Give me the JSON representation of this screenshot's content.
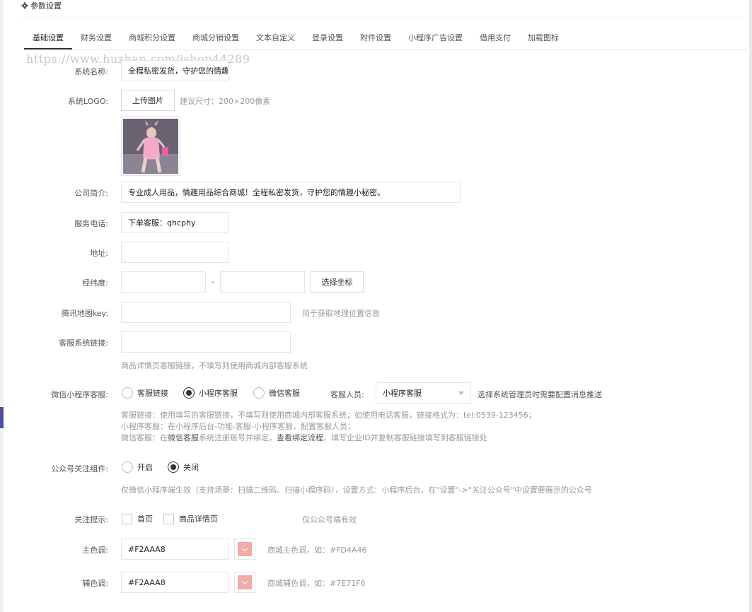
{
  "header": {
    "title": "参数设置",
    "icon": "gear-icon"
  },
  "tabs": [
    {
      "label": "基础设置",
      "active": true
    },
    {
      "label": "财务设置"
    },
    {
      "label": "商城积分设置"
    },
    {
      "label": "商城分销设置"
    },
    {
      "label": "文本自定义"
    },
    {
      "label": "登录设置"
    },
    {
      "label": "附件设置"
    },
    {
      "label": "小程序广告设置"
    },
    {
      "label": "借用支付"
    },
    {
      "label": "加载图标"
    }
  ],
  "watermark": "https://www.huzhan.com/ishop44289",
  "form": {
    "system_name": {
      "label": "系统名称:",
      "value": "全程私密发货，守护您的情趣"
    },
    "system_logo": {
      "label": "系统LOGO:",
      "upload_button": "上传图片",
      "hint": "建议尺寸：200×200像素"
    },
    "company_intro": {
      "label": "公司简介:",
      "value": "专业成人用品，情趣用品综合商城！全程私密发货，守护您的情趣小秘密。"
    },
    "service_phone": {
      "label": "服务电话:",
      "value": "下单客服：qhcphy"
    },
    "address": {
      "label": "地址:",
      "value": ""
    },
    "coords": {
      "label": "经纬度:",
      "lat": "",
      "lng": "",
      "separator": "-",
      "button": "选择坐标"
    },
    "tencent_map_key": {
      "label": "腾讯地图key:",
      "value": "",
      "hint": "用于获取地理位置信息"
    },
    "service_link": {
      "label": "客服系统链接:",
      "value": "",
      "hint": "商品详情页客服链接，不填写则使用商城内部客服系统"
    },
    "wx_service": {
      "label": "微信小程序客服:",
      "options": [
        "客服链接",
        "小程序客服",
        "微信客服"
      ],
      "selected": "小程序客服",
      "staff_label": "客服人员:",
      "staff_value": "小程序客服",
      "staff_hint": "选择系统管理员时需要配置消息推送",
      "desc1": "客服链接：使用填写的客服链接，不填写则使用商城内部客服系统；如使用电话客服，链接格式为：tel:0539-123456；",
      "desc2": "小程序客服：在小程序后台-功能-客服-小程序客服，配置客服人员；",
      "desc3_a": "微信客服：在",
      "desc3_b": "微信客服",
      "desc3_c": "系统注册账号并绑定，",
      "desc3_d": "查看绑定流程",
      "desc3_e": "，填写企业ID并复制客服链接填写到客服链接处"
    },
    "official_follow": {
      "label": "公众号关注组件:",
      "options": [
        "开启",
        "关闭"
      ],
      "selected": "关闭",
      "hint": "仅微信小程序端生效（支持场景：扫描二维码、扫描小程序码），设置方式：小程序后台，在\"设置\"->\"关注公众号\"中设置要展示的公众号"
    },
    "follow_tip": {
      "label": "关注提示:",
      "options": [
        "首页",
        "商品详情页"
      ],
      "checked": [],
      "hint": "仅公众号端有效"
    },
    "main_color": {
      "label": "主色调:",
      "value": "#F2AAA8",
      "swatch": "#F2AAA8",
      "hint": "商城主色调，如：#FD4A46"
    },
    "sub_color": {
      "label": "辅色调:",
      "value": "#F2AAA8",
      "swatch": "#F2AAA8",
      "hint": "商城辅色调，如：#7E71F6"
    }
  }
}
